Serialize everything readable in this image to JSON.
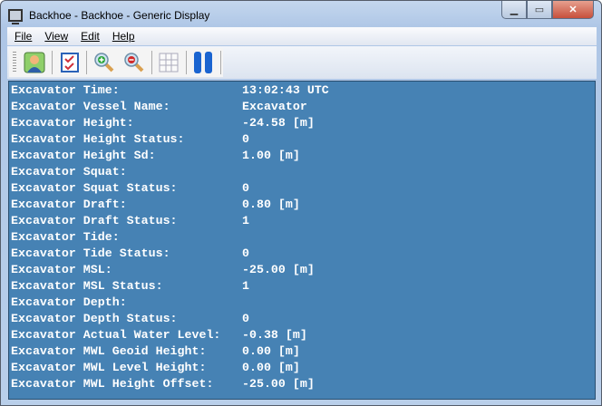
{
  "window": {
    "title": "Backhoe - Backhoe  - Generic Display"
  },
  "menu": [
    "File",
    "View",
    "Edit",
    "Help"
  ],
  "toolbar": [
    {
      "icon": "user-icon"
    },
    {
      "icon": "checklist-icon"
    },
    {
      "icon": "zoom-in-icon"
    },
    {
      "icon": "zoom-out-icon"
    },
    {
      "icon": "grid-icon"
    },
    {
      "icon": "pause-icon"
    }
  ],
  "colors": {
    "background": "#4682b4",
    "text": "#ffffff"
  },
  "rows": [
    {
      "label": "Excavator Time:",
      "value": "13:02:43 UTC"
    },
    {
      "label": "Excavator Vessel Name:",
      "value": "Excavator"
    },
    {
      "label": "Excavator Height:",
      "value": "-24.58 [m]"
    },
    {
      "label": "Excavator Height Status:",
      "value": "0"
    },
    {
      "label": "Excavator Height Sd:",
      "value": "1.00 [m]"
    },
    {
      "label": "Excavator Squat:",
      "value": ""
    },
    {
      "label": "Excavator Squat Status:",
      "value": "0"
    },
    {
      "label": "Excavator Draft:",
      "value": "0.80 [m]"
    },
    {
      "label": "Excavator Draft Status:",
      "value": "1"
    },
    {
      "label": "Excavator Tide:",
      "value": ""
    },
    {
      "label": "Excavator Tide Status:",
      "value": "0"
    },
    {
      "label": "Excavator MSL:",
      "value": "-25.00 [m]"
    },
    {
      "label": "Excavator MSL Status:",
      "value": "1"
    },
    {
      "label": "Excavator Depth:",
      "value": ""
    },
    {
      "label": "Excavator Depth Status:",
      "value": "0"
    },
    {
      "label": "Excavator Actual Water Level:",
      "value": "-0.38 [m]"
    },
    {
      "label": "Excavator MWL Geoid Height:",
      "value": "0.00 [m]"
    },
    {
      "label": "Excavator MWL Level Height:",
      "value": "0.00 [m]"
    },
    {
      "label": "Excavator MWL Height Offset:",
      "value": "-25.00 [m]"
    }
  ]
}
